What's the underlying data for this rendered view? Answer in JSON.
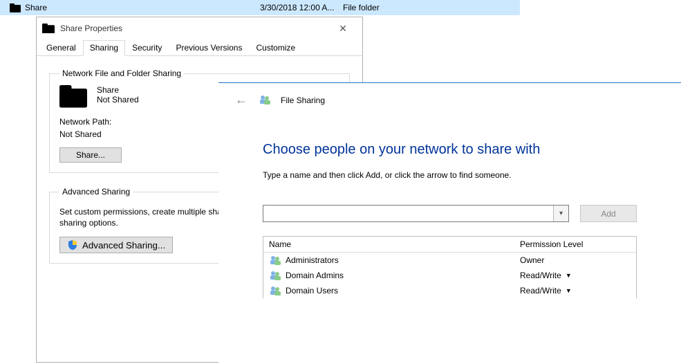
{
  "explorer_row": {
    "name": "Share",
    "date": "3/30/2018 12:00 A...",
    "type": "File folder"
  },
  "properties": {
    "window_title": "Share Properties",
    "tabs": {
      "general": "General",
      "sharing": "Sharing",
      "security": "Security",
      "previous": "Previous Versions",
      "customize": "Customize"
    },
    "group_network_title": "Network File and Folder Sharing",
    "item_name": "Share",
    "item_status": "Not Shared",
    "network_path_label": "Network Path:",
    "network_path_value": "Not Shared",
    "share_button": "Share...",
    "group_advanced_title": "Advanced Sharing",
    "advanced_text": "Set custom permissions, create multiple shares, and set other advanced sharing options.",
    "advanced_button": "Advanced Sharing..."
  },
  "file_sharing": {
    "header_title": "File Sharing",
    "headline": "Choose people on your network to share with",
    "instruction": "Type a name and then click Add, or click the arrow to find someone.",
    "add_button": "Add",
    "columns": {
      "name": "Name",
      "perm": "Permission Level"
    },
    "rows": [
      {
        "name": "Administrators",
        "perm": "Owner",
        "editable": false
      },
      {
        "name": "Domain Admins",
        "perm": "Read/Write",
        "editable": true
      },
      {
        "name": "Domain Users",
        "perm": "Read/Write",
        "editable": true
      }
    ]
  }
}
